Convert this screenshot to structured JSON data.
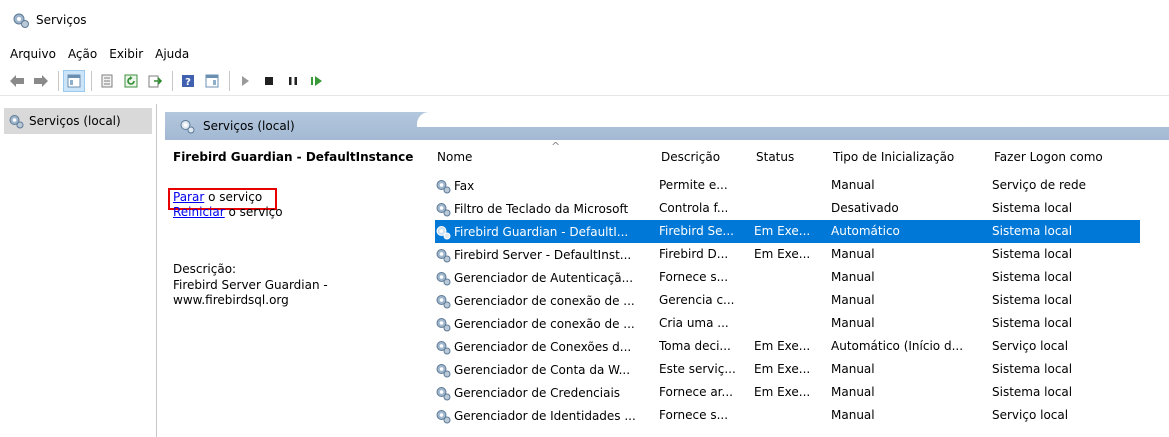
{
  "window": {
    "title": "Serviços"
  },
  "menu": [
    "Arquivo",
    "Ação",
    "Exibir",
    "Ajuda"
  ],
  "tree": {
    "item": "Serviços (local)"
  },
  "pane": {
    "header": "Serviços (local)"
  },
  "details": {
    "service_title": "Firebird Guardian - DefaultInstance",
    "stop_link": "Parar",
    "stop_rest": " o serviço",
    "restart_link": "Reiniciar",
    "restart_rest": " o serviço",
    "desc_label": "Descrição:",
    "desc_text": "Firebird Server Guardian - www.firebirdsql.org"
  },
  "columns": {
    "name": "Nome",
    "desc": "Descrição",
    "status": "Status",
    "start": "Tipo de Inicialização",
    "logon": "Fazer Logon como"
  },
  "services": [
    {
      "name": "Fax",
      "desc": "Permite e...",
      "status": "",
      "start": "Manual",
      "logon": "Serviço de rede"
    },
    {
      "name": "Filtro de Teclado da Microsoft",
      "desc": "Controla f...",
      "status": "",
      "start": "Desativado",
      "logon": "Sistema local"
    },
    {
      "name": "Firebird Guardian - DefaultI...",
      "desc": "Firebird Se...",
      "status": "Em Exe...",
      "start": "Automático",
      "logon": "Sistema local"
    },
    {
      "name": "Firebird Server - DefaultInst...",
      "desc": "Firebird D...",
      "status": "Em Exe...",
      "start": "Manual",
      "logon": "Sistema local"
    },
    {
      "name": "Gerenciador de Autenticaçã...",
      "desc": "Fornece s...",
      "status": "",
      "start": "Manual",
      "logon": "Sistema local"
    },
    {
      "name": "Gerenciador de conexão de ...",
      "desc": "Gerencia c...",
      "status": "",
      "start": "Manual",
      "logon": "Sistema local"
    },
    {
      "name": "Gerenciador de conexão de ...",
      "desc": "Cria uma ...",
      "status": "",
      "start": "Manual",
      "logon": "Sistema local"
    },
    {
      "name": "Gerenciador de Conexões d...",
      "desc": "Toma deci...",
      "status": "Em Exe...",
      "start": "Automático (Início d...",
      "logon": "Serviço local"
    },
    {
      "name": "Gerenciador de Conta da W...",
      "desc": "Este serviç...",
      "status": "Em Exe...",
      "start": "Manual",
      "logon": "Sistema local"
    },
    {
      "name": "Gerenciador de Credenciais",
      "desc": "Fornece ar...",
      "status": "Em Exe...",
      "start": "Manual",
      "logon": "Sistema local"
    },
    {
      "name": "Gerenciador de Identidades ...",
      "desc": "Fornece s...",
      "status": "",
      "start": "Manual",
      "logon": "Serviço local"
    }
  ],
  "colors": {
    "selection": "#0078d7",
    "highlight_box": "#e60000",
    "pane_header": "#b3c7dd"
  }
}
